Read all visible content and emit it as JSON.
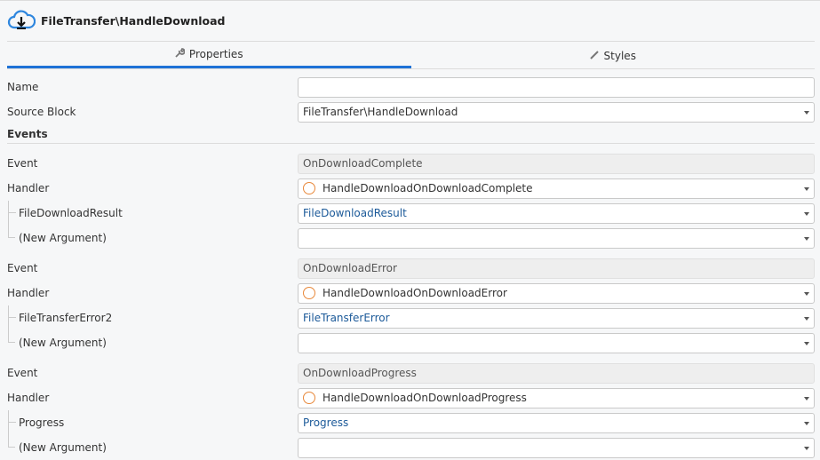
{
  "header": {
    "title": "FileTransfer\\HandleDownload",
    "icon": "cloud-download-icon"
  },
  "tabs": [
    {
      "label": "Properties",
      "icon": "wrench-icon",
      "active": true
    },
    {
      "label": "Styles",
      "icon": "brush-icon",
      "active": false
    }
  ],
  "form": {
    "name": {
      "label": "Name",
      "value": ""
    },
    "source_block": {
      "label": "Source Block",
      "value": "FileTransfer\\HandleDownload"
    },
    "events_heading": "Events",
    "events": [
      {
        "event_label": "Event",
        "event": "OnDownloadComplete",
        "handler_label": "Handler",
        "handler": "HandleDownloadOnDownloadComplete",
        "arg_label": "FileDownloadResult",
        "arg_value": "FileDownloadResult",
        "new_arg_label": "(New Argument)",
        "new_arg_value": ""
      },
      {
        "event_label": "Event",
        "event": "OnDownloadError",
        "handler_label": "Handler",
        "handler": "HandleDownloadOnDownloadError",
        "arg_label": "FileTransferError2",
        "arg_value": "FileTransferError",
        "new_arg_label": "(New Argument)",
        "new_arg_value": ""
      },
      {
        "event_label": "Event",
        "event": "OnDownloadProgress",
        "handler_label": "Handler",
        "handler": "HandleDownloadOnDownloadProgress",
        "arg_label": "Progress",
        "arg_value": "Progress",
        "new_arg_label": "(New Argument)",
        "new_arg_value": ""
      }
    ]
  },
  "colors": {
    "accent": "#1e72d6",
    "handler_circle": "#e8883a",
    "link": "#1c5a99"
  }
}
